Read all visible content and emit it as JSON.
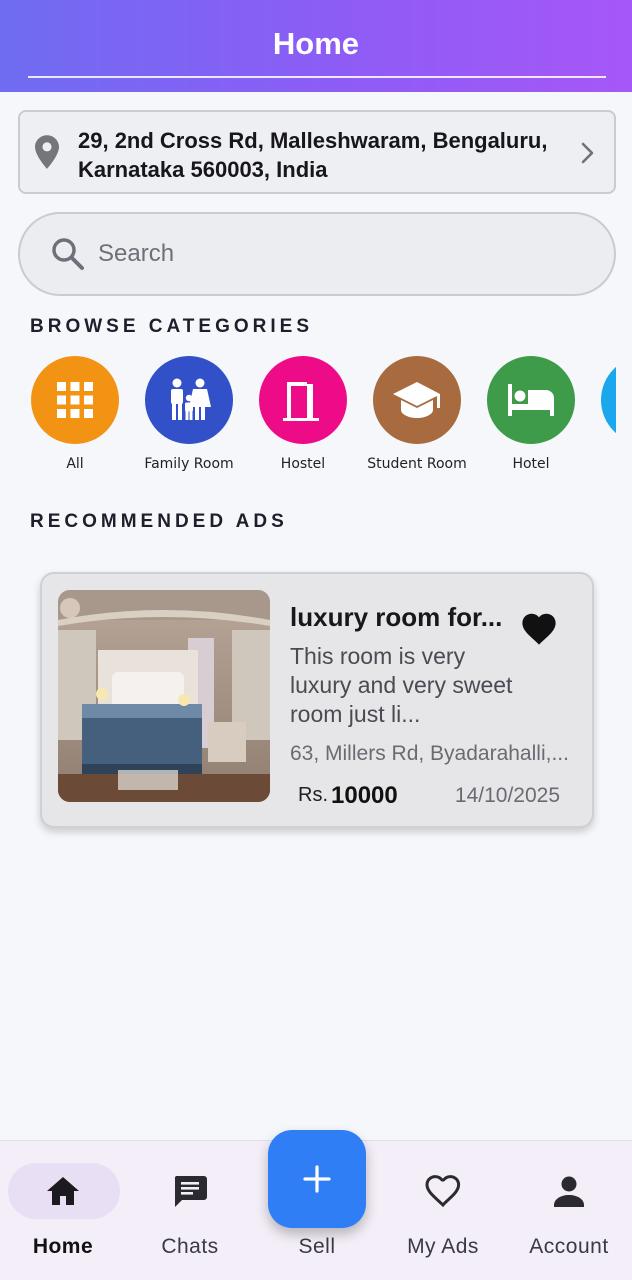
{
  "header": {
    "title": "Home"
  },
  "location": {
    "address": "29, 2nd Cross Rd, Malleshwaram, Bengaluru, Karnataka 560003, India",
    "icon": "location-pin-icon"
  },
  "search": {
    "placeholder": "Search"
  },
  "browse": {
    "title": "BROWSE CATEGORIES",
    "items": [
      {
        "label": "All",
        "color": "#f29313",
        "icon": "grid-icon"
      },
      {
        "label": "Family Room",
        "color": "#3251c8",
        "icon": "family-icon"
      },
      {
        "label": "Hostel",
        "color": "#ee0b88",
        "icon": "door-icon"
      },
      {
        "label": "Student Room",
        "color": "#a86a3f",
        "icon": "graduation-cap-icon"
      },
      {
        "label": "Hotel",
        "color": "#3e9b49",
        "icon": "bed-icon"
      },
      {
        "label": "",
        "color": "#1aa7ec",
        "icon": "category-icon"
      }
    ]
  },
  "recommended": {
    "title": "RECOMMENDED ADS",
    "ads": [
      {
        "title": "luxury room for...",
        "description": "This room is very luxury and very sweet room just li...",
        "location": "63, Millers Rd, Byadarahalli,...",
        "currency": "Rs.",
        "price": "10000",
        "date": "14/10/2025",
        "favorite": true
      }
    ]
  },
  "nav": {
    "items": [
      {
        "label": "Home",
        "icon": "home-icon",
        "active": true
      },
      {
        "label": "Chats",
        "icon": "chat-icon",
        "active": false
      },
      {
        "label": "Sell",
        "icon": "plus-icon",
        "active": false
      },
      {
        "label": "My Ads",
        "icon": "heart-outline-icon",
        "active": false
      },
      {
        "label": "Account",
        "icon": "person-icon",
        "active": false
      }
    ]
  },
  "colors": {
    "header_start": "#6f6cf2",
    "header_end": "#a657f7",
    "fab": "#2f7ef6"
  }
}
